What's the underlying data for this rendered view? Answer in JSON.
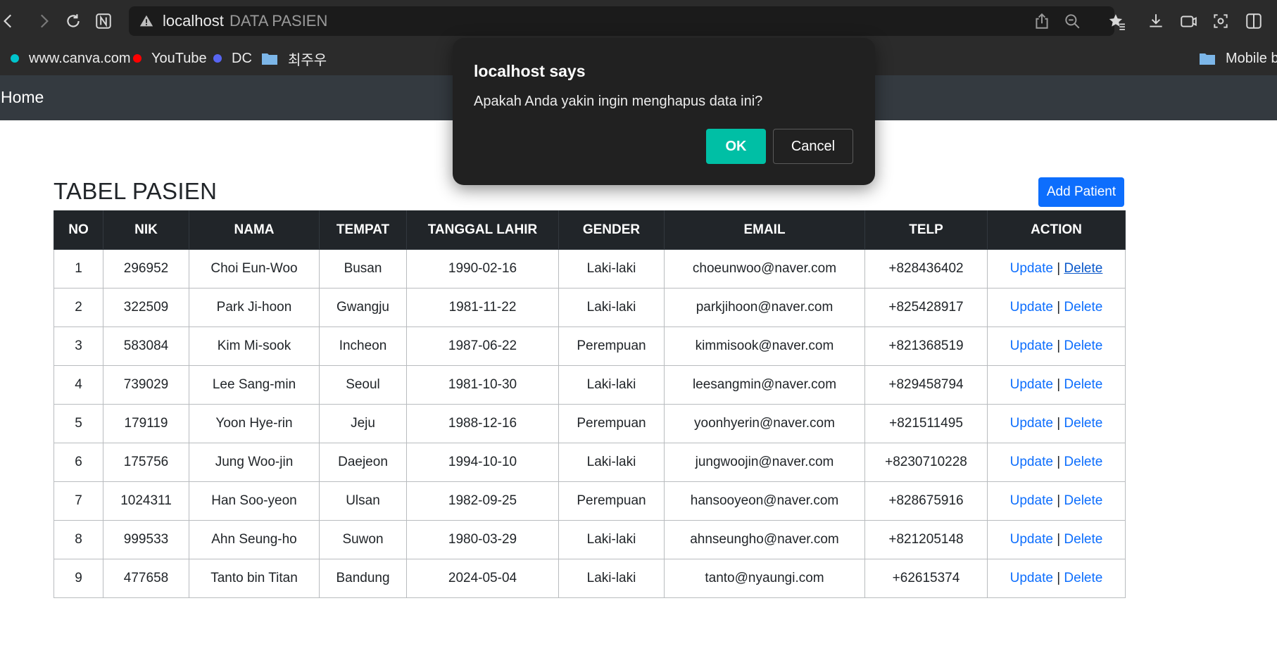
{
  "browser": {
    "address_host": "localhost",
    "page_title": "DATA PASIEN",
    "bookmarks": [
      {
        "label": "www.canva.com",
        "icon": "canva-icon",
        "color": "#00c4cc"
      },
      {
        "label": "YouTube",
        "icon": "youtube-icon",
        "color": "#ff0000"
      },
      {
        "label": "DC",
        "icon": "dc-icon",
        "color": "#5865f2"
      },
      {
        "label": "최주우",
        "icon": "folder-icon"
      }
    ],
    "bookmark_folder_right": "Mobile bo"
  },
  "navbar": {
    "home_label": "Home"
  },
  "main": {
    "heading": "TABEL PASIEN",
    "add_button": "Add Patient",
    "columns": [
      "NO",
      "NIK",
      "NAMA",
      "TEMPAT",
      "TANGGAL LAHIR",
      "GENDER",
      "EMAIL",
      "TELP",
      "ACTION"
    ],
    "rows": [
      {
        "no": "1",
        "nik": "296952",
        "nama": "Choi Eun-Woo",
        "tempat": "Busan",
        "tanggal": "1990-02-16",
        "gender": "Laki-laki",
        "email": "choeunwoo@naver.com",
        "telp": "+828436402"
      },
      {
        "no": "2",
        "nik": "322509",
        "nama": "Park Ji-hoon",
        "tempat": "Gwangju",
        "tanggal": "1981-11-22",
        "gender": "Laki-laki",
        "email": "parkjihoon@naver.com",
        "telp": "+825428917"
      },
      {
        "no": "3",
        "nik": "583084",
        "nama": "Kim Mi-sook",
        "tempat": "Incheon",
        "tanggal": "1987-06-22",
        "gender": "Perempuan",
        "email": "kimmisook@naver.com",
        "telp": "+821368519"
      },
      {
        "no": "4",
        "nik": "739029",
        "nama": "Lee Sang-min",
        "tempat": "Seoul",
        "tanggal": "1981-10-30",
        "gender": "Laki-laki",
        "email": "leesangmin@naver.com",
        "telp": "+829458794"
      },
      {
        "no": "5",
        "nik": "179119",
        "nama": "Yoon Hye-rin",
        "tempat": "Jeju",
        "tanggal": "1988-12-16",
        "gender": "Perempuan",
        "email": "yoonhyerin@naver.com",
        "telp": "+821511495"
      },
      {
        "no": "6",
        "nik": "175756",
        "nama": "Jung Woo-jin",
        "tempat": "Daejeon",
        "tanggal": "1994-10-10",
        "gender": "Laki-laki",
        "email": "jungwoojin@naver.com",
        "telp": "+8230710228"
      },
      {
        "no": "7",
        "nik": "1024311",
        "nama": "Han Soo-yeon",
        "tempat": "Ulsan",
        "tanggal": "1982-09-25",
        "gender": "Perempuan",
        "email": "hansooyeon@naver.com",
        "telp": "+828675916"
      },
      {
        "no": "8",
        "nik": "999533",
        "nama": "Ahn Seung-ho",
        "tempat": "Suwon",
        "tanggal": "1980-03-29",
        "gender": "Laki-laki",
        "email": "ahnseungho@naver.com",
        "telp": "+821205148"
      },
      {
        "no": "9",
        "nik": "477658",
        "nama": "Tanto bin Titan",
        "tempat": "Bandung",
        "tanggal": "2024-05-04",
        "gender": "Laki-laki",
        "email": "tanto@nyaungi.com",
        "telp": "+62615374"
      }
    ],
    "action_update": "Update",
    "action_separator": "|",
    "action_delete": "Delete"
  },
  "dialog": {
    "title": "localhost says",
    "message": "Apakah Anda yakin ingin menghapus data ini?",
    "ok_label": "OK",
    "cancel_label": "Cancel"
  },
  "colors": {
    "navbar_bg": "#343a40",
    "table_header_bg": "#212529",
    "link": "#0d6efd",
    "primary_button": "#0d6efd",
    "dialog_ok": "#00bfa5",
    "dialog_bg": "#212121"
  }
}
